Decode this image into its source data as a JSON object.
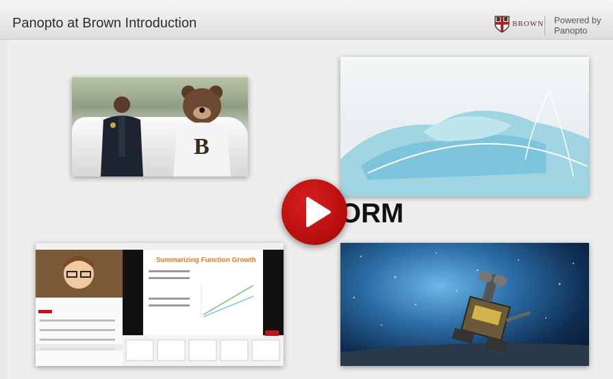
{
  "header": {
    "title": "Panopto at Brown Introduction",
    "brand_name": "BROWN",
    "powered_by_line1": "Powered by",
    "powered_by_line2": "Panopto"
  },
  "collage": {
    "overlay_text": "ORM",
    "screen_slide_title": "Summarizing Function Growth",
    "play_icon": "play-icon",
    "play_color": "#c4121a"
  },
  "colors": {
    "header_bg": "#e6e6e6",
    "brand_brown": "#4e3629",
    "play_red": "#c4121a"
  }
}
